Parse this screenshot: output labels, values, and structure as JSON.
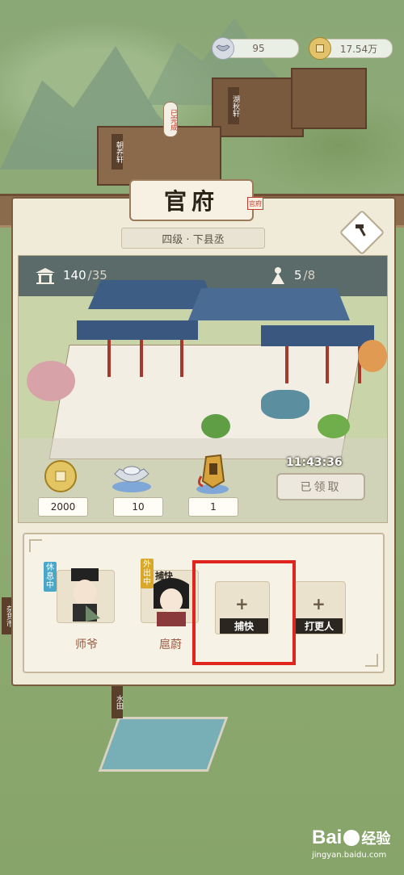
{
  "resources": {
    "silver": "95",
    "copper": "17.54万"
  },
  "map_signs": {
    "north_building": "湖秋轩",
    "gate_sign": "已完成",
    "east_sign": "朝养轩",
    "field_sign": "水田",
    "left_sign": "杂货市"
  },
  "panel": {
    "title": "官府",
    "seal_text": "官府",
    "rank": "四级 · 下县丞",
    "hammer_icon": "hammer-icon"
  },
  "scene": {
    "staff_icon": "pavilion-icon",
    "staff_count": "140",
    "staff_cap": "/35",
    "visitor_icon": "person-icon",
    "visitor_count": "5",
    "visitor_cap": "/8",
    "timer": "11:43:36",
    "claim_label": "已领取"
  },
  "rewards": [
    {
      "icon": "copper-coin-icon",
      "value": "2000"
    },
    {
      "icon": "silver-ingot-icon",
      "value": "10"
    },
    {
      "icon": "token-icon",
      "value": "1"
    }
  ],
  "staff": [
    {
      "name": "师爷",
      "status": "休息中",
      "status_color": "#4aa7c9"
    },
    {
      "name": "扈蔚",
      "status": "外出中",
      "status_color": "#d9a82a",
      "role_tag": "捕快"
    }
  ],
  "empty_slots": [
    {
      "label": "捕快"
    },
    {
      "label": "打更人"
    }
  ],
  "watermark": {
    "brand": "Bai",
    "brand2": "经验",
    "url": "jingyan.baidu.com"
  }
}
